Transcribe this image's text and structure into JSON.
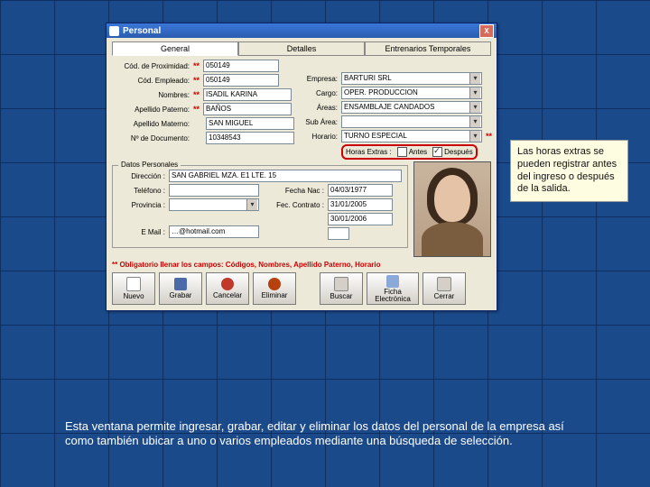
{
  "window": {
    "title": "Personal",
    "close": "X"
  },
  "tabs": {
    "t0": "General",
    "t1": "Detalles",
    "t2": "Entrenarios Temporales"
  },
  "left": {
    "lbl_prox": "Cód. de Proximidad:",
    "val_prox": "050149",
    "lbl_emp": "Cód. Empleado:",
    "val_emp": "050149",
    "lbl_nom": "Nombres:",
    "val_nom": "ISADIL KARINA",
    "lbl_apeP": "Apellido Paterno:",
    "val_apeP": "BAÑOS",
    "lbl_apeM": "Apellido Materno:",
    "val_apeM": "SAN MIGUEL",
    "lbl_doc": "Nº de Documento:",
    "val_doc": "10348543"
  },
  "right": {
    "lbl_empresa": "Empresa:",
    "val_empresa": "BARTURI SRL",
    "lbl_cargo": "Cargo:",
    "val_cargo": "OPER. PRODUCCION",
    "lbl_areas": "Áreas:",
    "val_areas": "ENSAMBLAJE CANDADOS",
    "lbl_sub": "Sub Área:",
    "val_sub": "",
    "lbl_hor": "Horario:",
    "val_hor": "TURNO ESPECIAL"
  },
  "extras": {
    "label": "Horas Extras :",
    "antes": "Antes",
    "despues": "Después"
  },
  "group": {
    "title": "Datos Personales",
    "lbl_dir": "Dirección :",
    "val_dir": "SAN GABRIEL MZA. E1 LTE. 15",
    "lbl_tel": "Teléfono :",
    "val_tel": "",
    "lbl_prov": "Provincia :",
    "val_prov": "",
    "lbl_mail": "E Mail :",
    "val_mail": "…@hotmail.com",
    "lbl_fnac": "Fecha Nac :",
    "val_fnac": "04/03/1977",
    "lbl_fcon": "Fec. Contrato :",
    "val_fcon": "31/01/2005",
    "lbl_fces": "",
    "val_fces": "30/01/2006",
    "lbl_obs": ""
  },
  "required": "** Obligatorio llenar los campos: Códigos, Nombres, Apellido Paterno, Horario",
  "buttons": {
    "nuevo": "Nuevo",
    "grabar": "Grabar",
    "cancelar": "Cancelar",
    "eliminar": "Eliminar",
    "buscar": "Buscar",
    "ficha": "Ficha Electrónica",
    "cerrar": "Cerrar"
  },
  "callout": "Las horas extras se pueden registrar antes del ingreso o después de la salida.",
  "caption": "Esta ventana permite ingresar, grabar, editar y eliminar los datos del personal de la empresa así como también ubicar a uno o varios empleados mediante una búsqueda de selección."
}
